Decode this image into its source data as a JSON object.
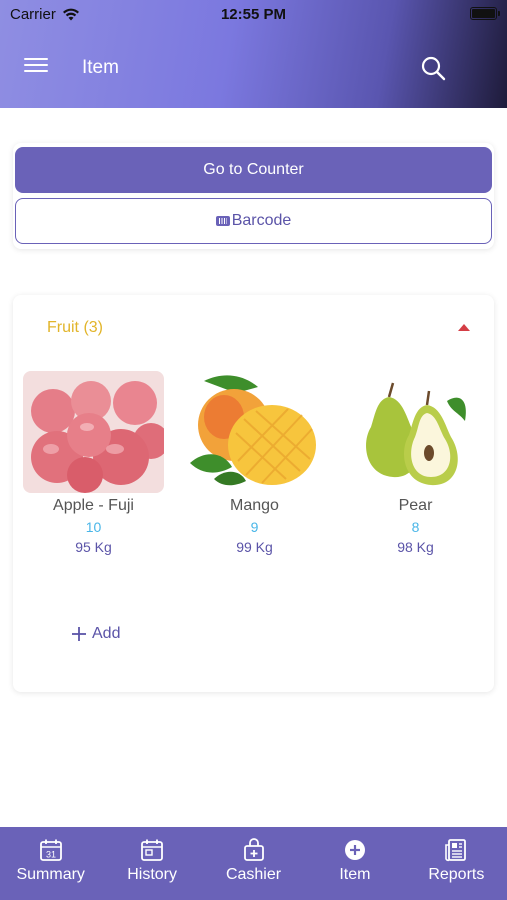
{
  "status_bar": {
    "carrier": "Carrier",
    "time": "12:55 PM"
  },
  "header": {
    "title": "Item"
  },
  "actions": {
    "counter_label": "Go to Counter",
    "barcode_label": "Barcode"
  },
  "category": {
    "title": "Fruit (3)",
    "items": [
      {
        "name": "Apple - Fuji",
        "stock": "10",
        "price": "95 Kg"
      },
      {
        "name": "Mango",
        "stock": "9",
        "price": "99 Kg"
      },
      {
        "name": "Pear",
        "stock": "8",
        "price": "98 Kg"
      }
    ],
    "add_label": "Add"
  },
  "tabs": [
    {
      "label": "Summary",
      "icon": "calendar-icon",
      "calendar_day": "31"
    },
    {
      "label": "History",
      "icon": "history-icon"
    },
    {
      "label": "Cashier",
      "icon": "cashier-icon"
    },
    {
      "label": "Item",
      "icon": "add-circle-icon"
    },
    {
      "label": "Reports",
      "icon": "reports-icon"
    }
  ],
  "colors": {
    "primary": "#6a62b8",
    "category_title": "#e2b52b",
    "stock": "#49b6e8",
    "collapse_indicator": "#d43d45"
  }
}
